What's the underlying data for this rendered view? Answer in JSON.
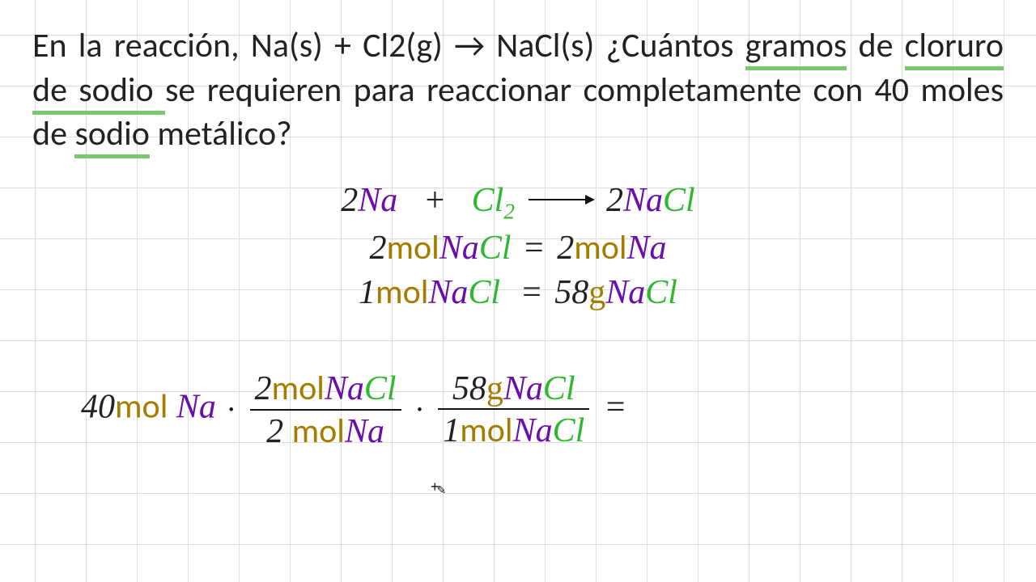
{
  "problem": {
    "p1a": "En la reacción, Na(s) + Cl2(g) → NaCl(s) ¿Cuántos ",
    "p1b_ul": "gramos",
    "p1c": " de ",
    "p2a_ul": "cloruro de sodio ",
    "p2b": "se requieren para reaccionar completamente con 40 moles de ",
    "p2c_ul": "sodio",
    "p2d": " metálico?"
  },
  "equation": {
    "c1": "2",
    "r1": "Na",
    "plus": "+",
    "r2a": "Cl",
    "r2sub": "2",
    "c2": "2",
    "p1": "Na",
    "p2": "Cl"
  },
  "rel1": {
    "a1": "2",
    "a2": "mol",
    "a3": "Na",
    "a4": "Cl",
    "eq": "=",
    "b1": "2",
    "b2": "mol",
    "b3": "Na"
  },
  "rel2": {
    "a1": "1",
    "a2": "mol",
    "a3": "Na",
    "a4": "Cl",
    "eq": "=",
    "b1": "58",
    "b2": "g",
    "b3": "Na",
    "b4": "Cl"
  },
  "calc": {
    "start_n": "40",
    "start_u": "mol",
    "start_s": "Na",
    "f1": {
      "n1": "2",
      "n2": "mol",
      "n3": "Na",
      "n4": "Cl",
      "d1": "2",
      "d2": "mol",
      "d3": "Na"
    },
    "f2": {
      "n1": "58",
      "n2": "g",
      "n3": "Na",
      "n4": "Cl",
      "d1": "1",
      "d2": "mol",
      "d3": "Na",
      "d4": "Cl"
    },
    "eq": "="
  },
  "colors": {
    "purple": "#6a0dad",
    "green": "#2fb82f",
    "brown": "#a67c00",
    "underline": "#7bc96f"
  }
}
